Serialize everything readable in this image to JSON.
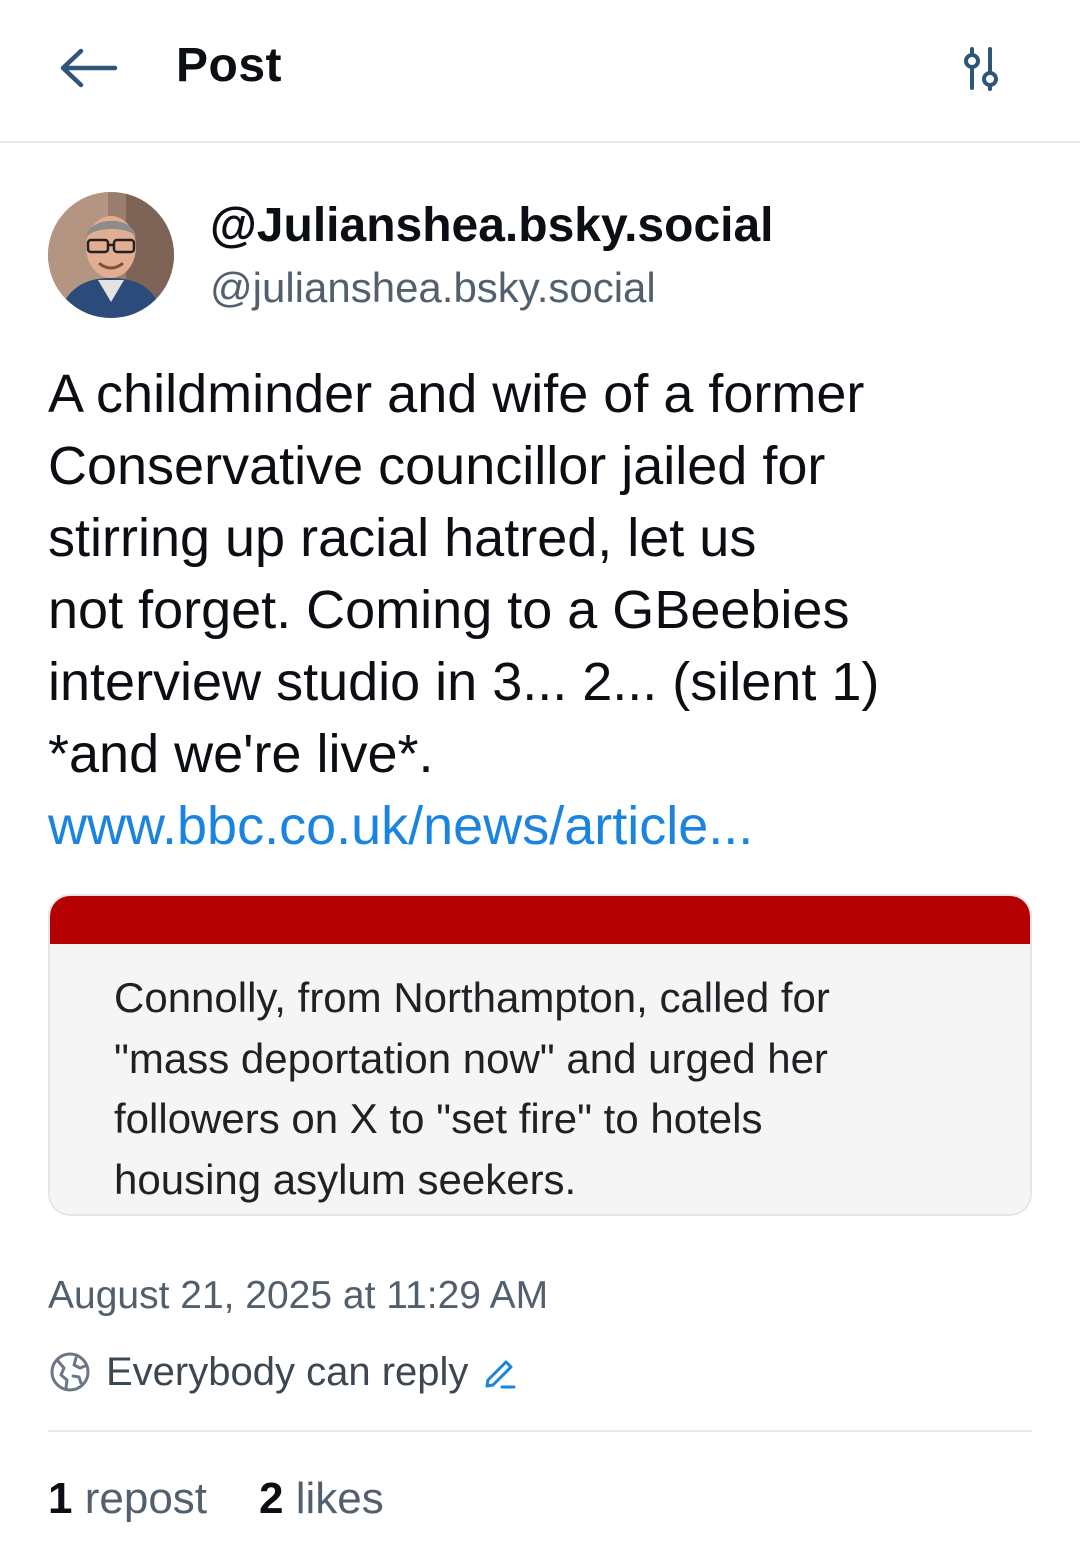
{
  "header": {
    "title": "Post",
    "back_icon": "arrow-left-icon",
    "filter_icon": "sliders-icon"
  },
  "author": {
    "display_name": "@Julianshea.bsky.social",
    "handle": "@julianshea.bsky.social"
  },
  "post": {
    "text_lines": [
      "A childminder and wife of a former",
      "Conservative councillor jailed for",
      "stirring up racial hatred, let us",
      "not forget. Coming to a GBeebies",
      "interview studio in 3... 2... (silent 1)",
      "*and we're live*."
    ],
    "link": "www.bbc.co.uk/news/article..."
  },
  "embed": {
    "bar_color": "#b40000",
    "text_lines": [
      "Connolly, from Northampton, called for",
      "\"mass deportation now\" and urged her",
      "followers on X to \"set fire\" to hotels",
      "housing asylum seekers."
    ]
  },
  "meta": {
    "timestamp": "August 21, 2025 at 11:29 AM",
    "reply_setting": "Everybody can reply"
  },
  "stats": {
    "reposts_count": "1",
    "reposts_label": "repost",
    "likes_count": "2",
    "likes_label": "likes"
  },
  "colors": {
    "link": "#1b84e0",
    "muted": "#52606d",
    "text": "#0b0f14"
  }
}
